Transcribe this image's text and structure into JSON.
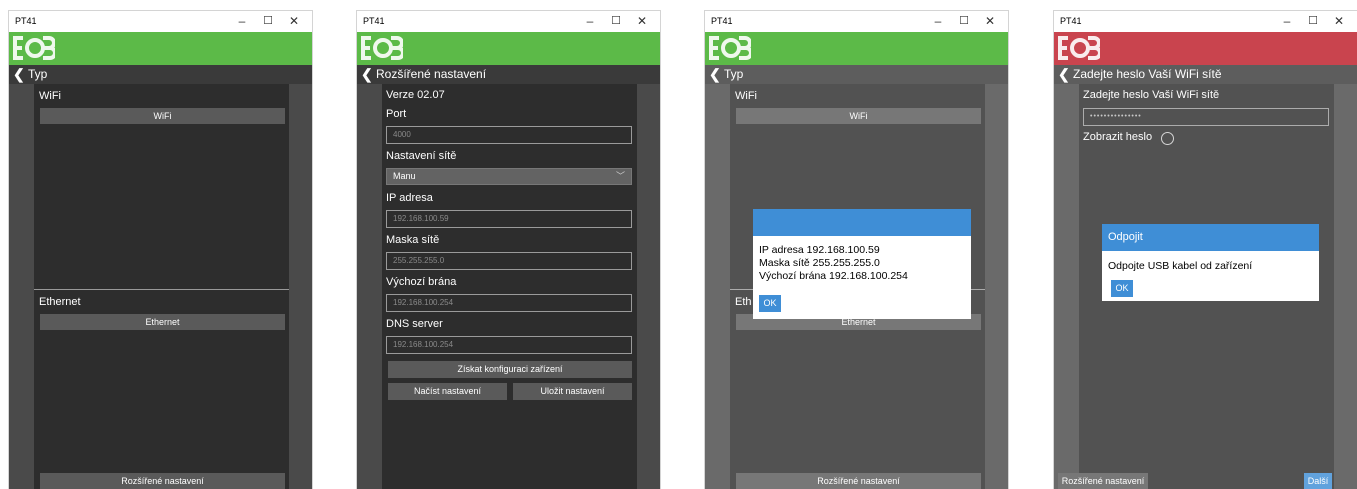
{
  "colors": {
    "green": "#5cba48",
    "red": "#c9444e",
    "accent": "#3f8ed6"
  },
  "window": {
    "title": "PT41",
    "min_glyph": "–",
    "max_glyph": "☐",
    "close_glyph": "✕"
  },
  "back_icon": "❮",
  "screen1": {
    "nav_title": "Typ",
    "wifi_label": "WiFi",
    "wifi_button": "WiFi",
    "ethernet_label": "Ethernet",
    "ethernet_button": "Ethernet",
    "advanced_button": "Rozšířené nastavení"
  },
  "screen2": {
    "nav_title": "Rozšířené nastavení",
    "version": "Verze 02.07",
    "port_label": "Port",
    "port_value": "4000",
    "network_label": "Nastavení sítě",
    "network_value": "Manu",
    "ip_label": "IP adresa",
    "ip_value": "192.168.100.59",
    "mask_label": "Maska sítě",
    "mask_value": "255.255.255.0",
    "gateway_label": "Výchozí brána",
    "gateway_value": "192.168.100.254",
    "dns_label": "DNS server",
    "dns_value": "192.168.100.254",
    "get_config_button": "Získat konfiguraci zařízení",
    "load_button": "Načíst nastavení",
    "save_button": "Uložit nastavení"
  },
  "screen3": {
    "nav_title": "Typ",
    "wifi_label": "WiFi",
    "wifi_button": "WiFi",
    "ethernet_label": "Eth",
    "ethernet_button": "Ethernet",
    "advanced_button": "Rozšířené nastavení",
    "dialog_line1": "IP adresa 192.168.100.59",
    "dialog_line2": "Maska sítě 255.255.255.0",
    "dialog_line3": "Výchozí brána 192.168.100.254",
    "ok": "OK"
  },
  "screen4": {
    "nav_title": "Zadejte heslo Vaší WiFi sítě",
    "password_label": "Zadejte heslo Vaší WiFi sítě",
    "password_value": "•••••••••••••••",
    "show_password_label": "Zobrazit heslo",
    "advanced_button": "Rozšířené nastavení",
    "next_button": "Další",
    "dialog_title": "Odpojit",
    "dialog_text": "Odpojte USB kabel od zařízení",
    "ok": "OK"
  }
}
